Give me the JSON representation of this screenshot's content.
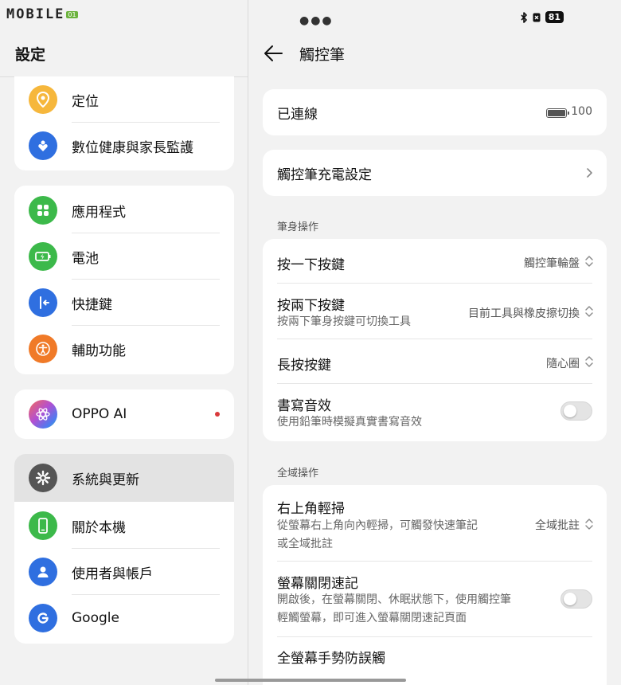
{
  "watermark": {
    "text": "MOBILE",
    "sub": "01"
  },
  "left": {
    "title": "設定",
    "groups": [
      {
        "items": [
          {
            "label": "定位",
            "icon": "location-icon",
            "color": "#f6b73c"
          },
          {
            "label": "數位健康與家長監護",
            "icon": "wellbeing-heart-icon",
            "color": "#2f6fe0"
          }
        ]
      },
      {
        "items": [
          {
            "label": "應用程式",
            "icon": "apps-grid-icon",
            "color": "#3cb94a"
          },
          {
            "label": "電池",
            "icon": "battery-icon",
            "color": "#3cb94a"
          },
          {
            "label": "快捷鍵",
            "icon": "shortcut-icon",
            "color": "#2f6fe0"
          },
          {
            "label": "輔助功能",
            "icon": "accessibility-icon",
            "color": "#f07a28"
          }
        ]
      },
      {
        "items": [
          {
            "label": "OPPO AI",
            "icon": "oppo-ai-icon",
            "color": "#b34fd1"
          }
        ]
      },
      {
        "items": [
          {
            "label": "系統與更新",
            "icon": "gear-icon",
            "color": "#555555"
          },
          {
            "label": "關於本機",
            "icon": "phone-icon",
            "color": "#3cb94a"
          },
          {
            "label": "使用者與帳戶",
            "icon": "user-icon",
            "color": "#2f6fe0"
          },
          {
            "label": "Google",
            "icon": "google-icon",
            "color": "#2f6fe0"
          }
        ]
      }
    ]
  },
  "right": {
    "status": {
      "battery": "81"
    },
    "title": "觸控筆",
    "connection": {
      "label": "已連線",
      "battery": "100"
    },
    "charge_setting": {
      "label": "觸控筆充電設定"
    },
    "section_pen": "筆身操作",
    "pen_items": [
      {
        "title": "按一下按鍵",
        "value": "觸控筆輪盤"
      },
      {
        "title": "按兩下按鍵",
        "subtitle": "按兩下筆身按鍵可切換工具",
        "value": "目前工具與橡皮擦切換"
      },
      {
        "title": "長按按鍵",
        "value": "隨心圈"
      },
      {
        "title": "書寫音效",
        "subtitle": "使用鉛筆時模擬真實書寫音效",
        "toggle": "off"
      }
    ],
    "section_global": "全域操作",
    "global_items": [
      {
        "title": "右上角輕掃",
        "subtitle_line1": "從螢幕右上角向內輕掃，可觸發快速筆記",
        "subtitle_line2": "或全域批註",
        "value": "全域批註"
      },
      {
        "title": "螢幕關閉速記",
        "subtitle_line1": "開啟後，在螢幕關閉、休眠狀態下，使用觸控筆",
        "subtitle_line2": "輕觸螢幕，即可進入螢幕關閉速記頁面",
        "toggle": "off"
      },
      {
        "title": "全螢幕手勢防誤觸"
      }
    ]
  }
}
